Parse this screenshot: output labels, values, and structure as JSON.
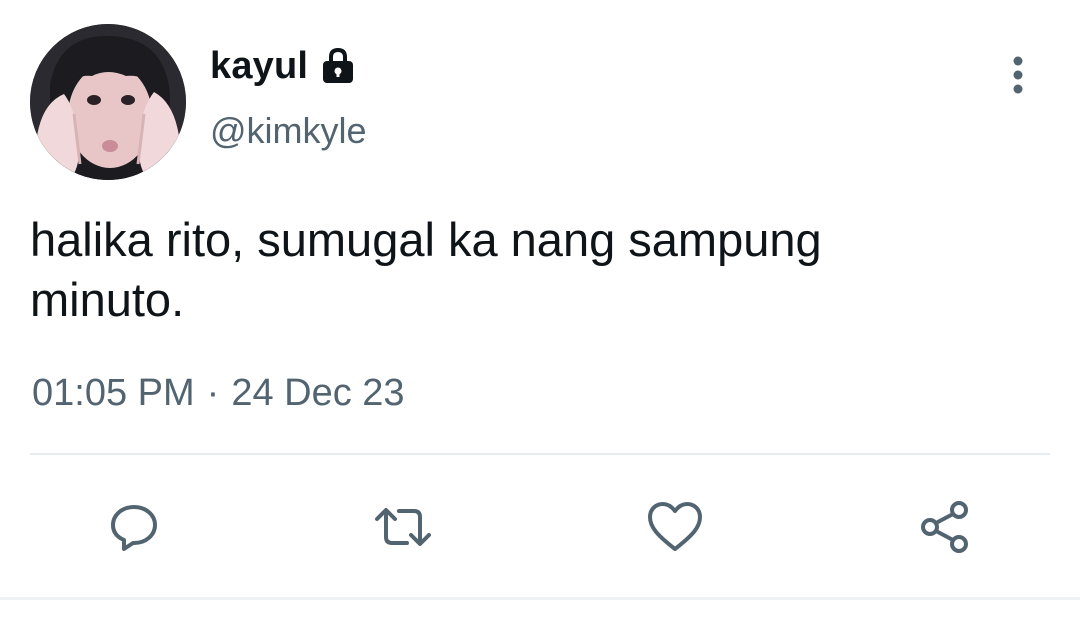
{
  "author": {
    "display_name": "kayul",
    "handle": "@kimkyle",
    "protected": true
  },
  "tweet": {
    "text": "halika rito, sumugal ka nang sampung\nminuto.",
    "time": "01:05 PM",
    "separator": "·",
    "date": "24 Dec 23"
  },
  "actions": {
    "reply_icon": "reply-icon",
    "retweet_icon": "retweet-icon",
    "like_icon": "heart-icon",
    "share_icon": "share-icon"
  },
  "colors": {
    "text_primary": "#0f1419",
    "text_secondary": "#536471",
    "divider": "#e6ecf0",
    "icon": "#536471"
  }
}
